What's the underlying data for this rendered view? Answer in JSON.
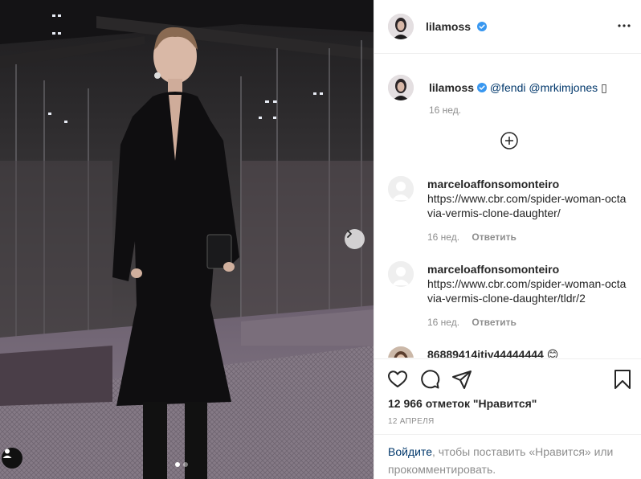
{
  "post": {
    "username": "lilamoss",
    "more_icon": "more-horizontal-icon",
    "verified_icon": "verified-badge-icon"
  },
  "caption": {
    "username": "lilamoss",
    "mention1": "@fendi",
    "mention2": "@mrkimjones",
    "trailing": "▯",
    "time": "16 нед."
  },
  "load_more_icon": "plus-circle-icon",
  "comments": [
    {
      "username": "marceloaffonsomonteiro",
      "text": "https://www.cbr.com/spider-woman-octavia-vermis-clone-daughter/",
      "time": "16 нед.",
      "reply": "Ответить"
    },
    {
      "username": "marceloaffonsomonteiro",
      "text": "https://www.cbr.com/spider-woman-octavia-vermis-clone-daughter/tldr/2",
      "time": "16 нед.",
      "reply": "Ответить"
    },
    {
      "username": "86889414itiy44444444 😊",
      "text": "",
      "time": "",
      "reply": ""
    }
  ],
  "actions": {
    "like_icon": "heart-icon",
    "comment_icon": "comment-icon",
    "share_icon": "send-icon",
    "save_icon": "bookmark-icon",
    "likes": "12 966 отметок \"Нравится\"",
    "date": "12 АПРЕЛЯ"
  },
  "login": {
    "link": "Войдите",
    "text": ", чтобы поставить «Нравится» или прокомментировать."
  },
  "carousel": {
    "next_icon": "chevron-right-icon",
    "tag_icon": "user-tag-icon",
    "slides": 2,
    "active_slide": 1
  },
  "colors": {
    "verified": "#3897f0",
    "link": "#00376b",
    "muted": "#8e8e8e",
    "text": "#262626",
    "border": "#efefef"
  }
}
